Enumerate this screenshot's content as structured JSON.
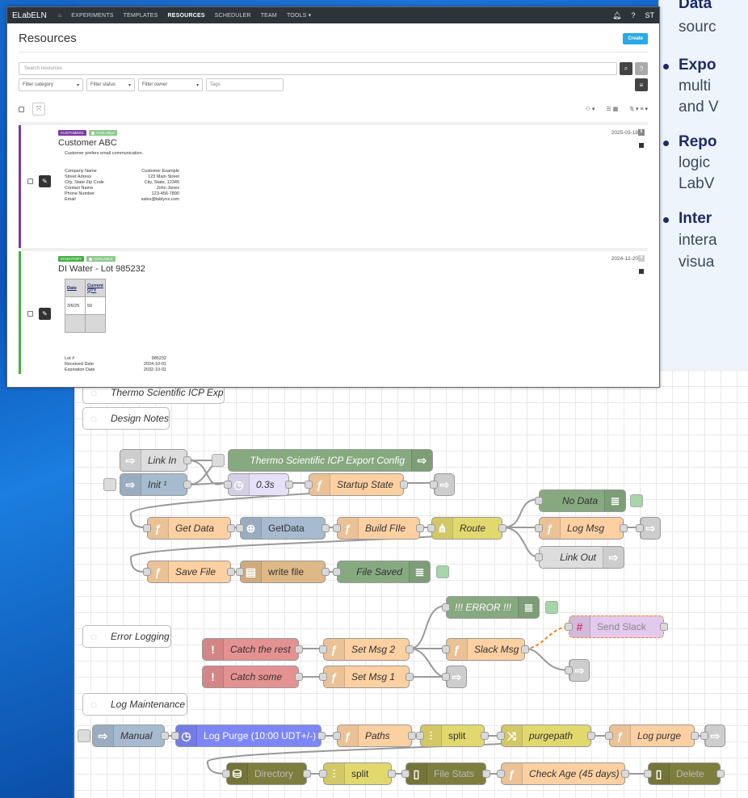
{
  "bullets": [
    {
      "text": "Data",
      "bold": true
    },
    {
      "text": "sourc",
      "bold": false
    },
    {
      "text": "Expo",
      "bold": true,
      "dot": true
    },
    {
      "text": "multi",
      "bold": false
    },
    {
      "text": "and V",
      "bold": false
    },
    {
      "text": "Repo",
      "bold": true,
      "dot": true
    },
    {
      "text": "logic",
      "bold": false
    },
    {
      "text": "LabV",
      "bold": false
    },
    {
      "text": "Inter",
      "bold": true,
      "dot": true
    },
    {
      "text": "intera",
      "bold": false
    },
    {
      "text": "visua",
      "bold": false
    }
  ],
  "eln": {
    "brand": "ELabELN",
    "nav": [
      "EXPERIMENTS",
      "TEMPLATES",
      "RESOURCES",
      "SCHEDULER",
      "TEAM",
      "TOOLS ▾"
    ],
    "active_nav": "RESOURCES",
    "user": "ST",
    "title": "Resources",
    "create_label": "Create",
    "search_placeholder": "Search resources",
    "filters": {
      "category": "Filter category",
      "status": "Filter status",
      "owner": "Filter owner",
      "tags_placeholder": "Tags"
    },
    "resources": [
      {
        "category": "CUSTOMERS",
        "status": "AVAILABLE",
        "title": "Customer ABC",
        "date": "2025-03-18",
        "note": "Customer prefers email communication.",
        "fields": [
          {
            "k": "Company Name",
            "v": "Customer Example"
          },
          {
            "k": "Street Adress",
            "v": "123 Main Street"
          },
          {
            "k": "City, State Zip Code",
            "v": "City, State, 12345"
          },
          {
            "k": "Contact Name",
            "v": "John Jones"
          },
          {
            "k": "Phone Number",
            "v": "123-456-7890"
          },
          {
            "k": "Email",
            "v": "sales@lablynx.com"
          }
        ]
      },
      {
        "category": "INVENTORY",
        "status": "AVAILABLE",
        "title": "DI Water - Lot 985232",
        "date": "2024-12-20",
        "table_headers": [
          "Date",
          "Current QTY"
        ],
        "table_row": [
          "3/6/25",
          "50"
        ],
        "fields": [
          {
            "k": "Lot #",
            "v": "985232"
          },
          {
            "k": "Received Date",
            "v": "2024-10-01"
          },
          {
            "k": "Expiration Date",
            "v": "2032-10-01"
          }
        ]
      }
    ]
  },
  "flow": {
    "comments": {
      "export_title": "Thermo Scientific ICP Export",
      "design_notes": "Design Notes",
      "error_logging": "Error Logging",
      "log_maintenance": "Log Maintenance"
    },
    "nodes": {
      "link_in": "Link In",
      "config": "Thermo Scientific ICP Export Config",
      "init": "Init ¹",
      "delay": "0.3s",
      "startup": "Startup State",
      "no_data": "No Data",
      "get_data_fn": "Get Data",
      "get_data_http": "GetData",
      "build_file": "Build FIle",
      "route": "Route",
      "log_msg": "Log Msg",
      "link_out": "Link Out",
      "save_file": "Save File",
      "write_file": "write file",
      "file_saved": "File Saved",
      "error": "!!! ERROR !!!",
      "catch_rest": "Catch the rest",
      "set_msg2": "Set Msg 2",
      "slack_msg": "Slack Msg",
      "send_slack": "Send Slack",
      "catch_some": "Catch some",
      "set_msg1": "Set Msg 1",
      "manual": "Manual",
      "log_purge_inject": "Log Purge (10:00 UDT+/-)",
      "paths": "Paths",
      "split1": "split",
      "purgepath": "purgepath",
      "log_purge": "Log purge",
      "directory": "Directory",
      "split2": "split",
      "file_stats": "File Stats",
      "check_age": "Check Age (45 days)",
      "delete": "Delete"
    }
  }
}
